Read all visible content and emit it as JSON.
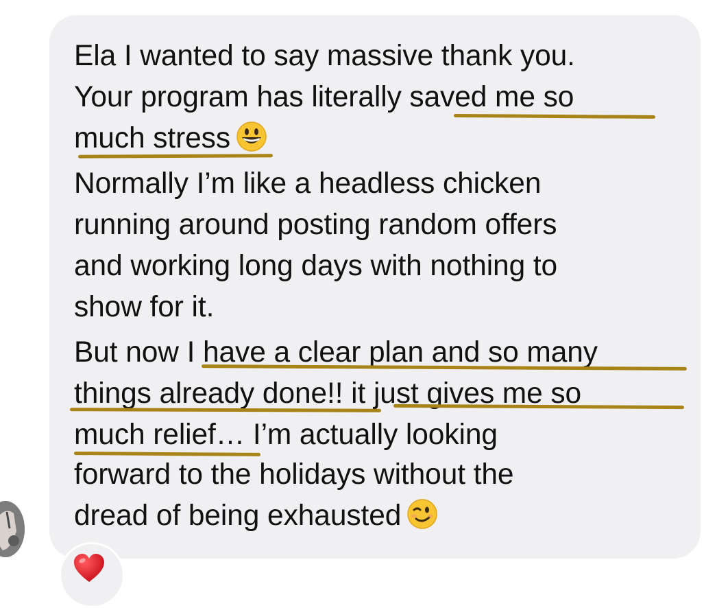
{
  "message": {
    "lines": [
      "Ela I wanted to say massive thank you.",
      "Your program has literally saved me so",
      "much stress",
      "Normally I’m like a headless chicken",
      "running around posting random offers",
      "and working long days with nothing to",
      "show for it.",
      "But now I have a clear plan and so many",
      "things already done!! it just gives me so",
      "much relief… I’m actually looking",
      "forward to the holidays without the",
      "dread of being exhausted"
    ],
    "emojis": [
      "grinning-face",
      "winking-face"
    ]
  },
  "reaction": {
    "icon": "red-heart"
  },
  "colors": {
    "bubble": "#f0f0f2",
    "text": "#111111",
    "underline": "#a88418",
    "heart": "#e0121b"
  }
}
